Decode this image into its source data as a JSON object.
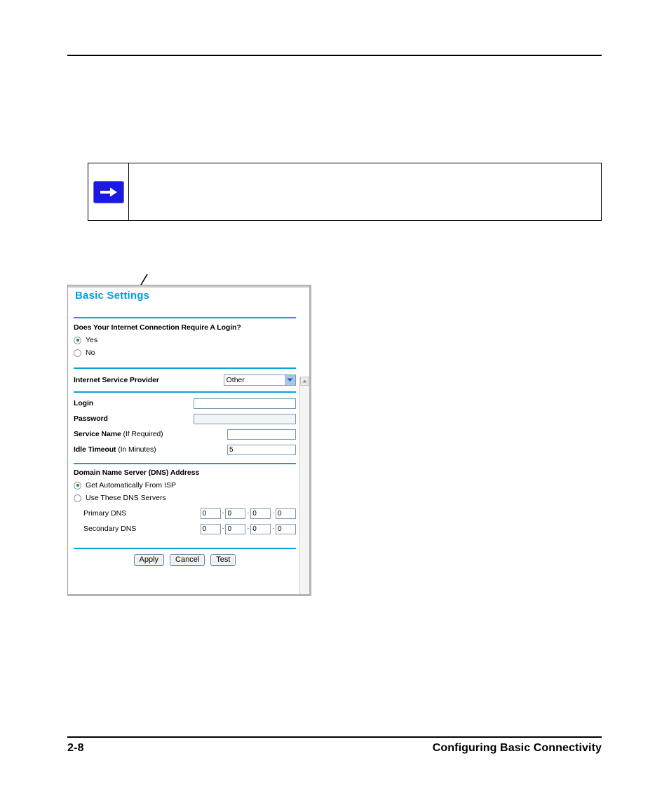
{
  "document": {
    "footer": {
      "page_number": "2-8",
      "chapter_title": "Configuring Basic Connectivity"
    }
  },
  "note_box": {
    "icon": "blue-right-arrow-icon",
    "text": ""
  },
  "callout": {
    "arrow": "leader-line-arrow",
    "points_to": "yes-radio"
  },
  "router_ui": {
    "title": "Basic Settings",
    "login_section": {
      "question": "Does Your Internet Connection Require A Login?",
      "options": [
        {
          "label": "Yes",
          "selected": true
        },
        {
          "label": "No",
          "selected": false
        }
      ]
    },
    "isp_section": {
      "label": "Internet Service Provider",
      "selected_option": "Other"
    },
    "credentials": {
      "login_label": "Login",
      "login_value": "",
      "password_label": "Password",
      "password_value": "",
      "service_name_label_bold": "Service Name",
      "service_name_label_light": "(If Required)",
      "service_name_value": "",
      "idle_timeout_label_bold": "Idle Timeout",
      "idle_timeout_label_light": "(In Minutes)",
      "idle_timeout_value": "5"
    },
    "dns_section": {
      "heading": "Domain Name Server (DNS) Address",
      "options": [
        {
          "label": "Get Automatically From ISP",
          "selected": true
        },
        {
          "label": "Use These DNS Servers",
          "selected": false
        }
      ],
      "primary_dns_label": "Primary DNS",
      "primary_dns_octets": [
        "0",
        "0",
        "0",
        "0"
      ],
      "secondary_dns_label": "Secondary DNS",
      "secondary_dns_octets": [
        "0",
        "0",
        "0",
        "0"
      ],
      "separator": "."
    },
    "buttons": {
      "apply": "Apply",
      "cancel": "Cancel",
      "test": "Test"
    },
    "scrollbar": {
      "up_arrow": "scroll-up-arrow-icon"
    },
    "colors": {
      "title_blue": "#00a0dc",
      "divider_blue": "#0ba1dd",
      "radio_dot_green": "#1f8f1f",
      "note_badge_blue": "#1a1ae0"
    }
  }
}
